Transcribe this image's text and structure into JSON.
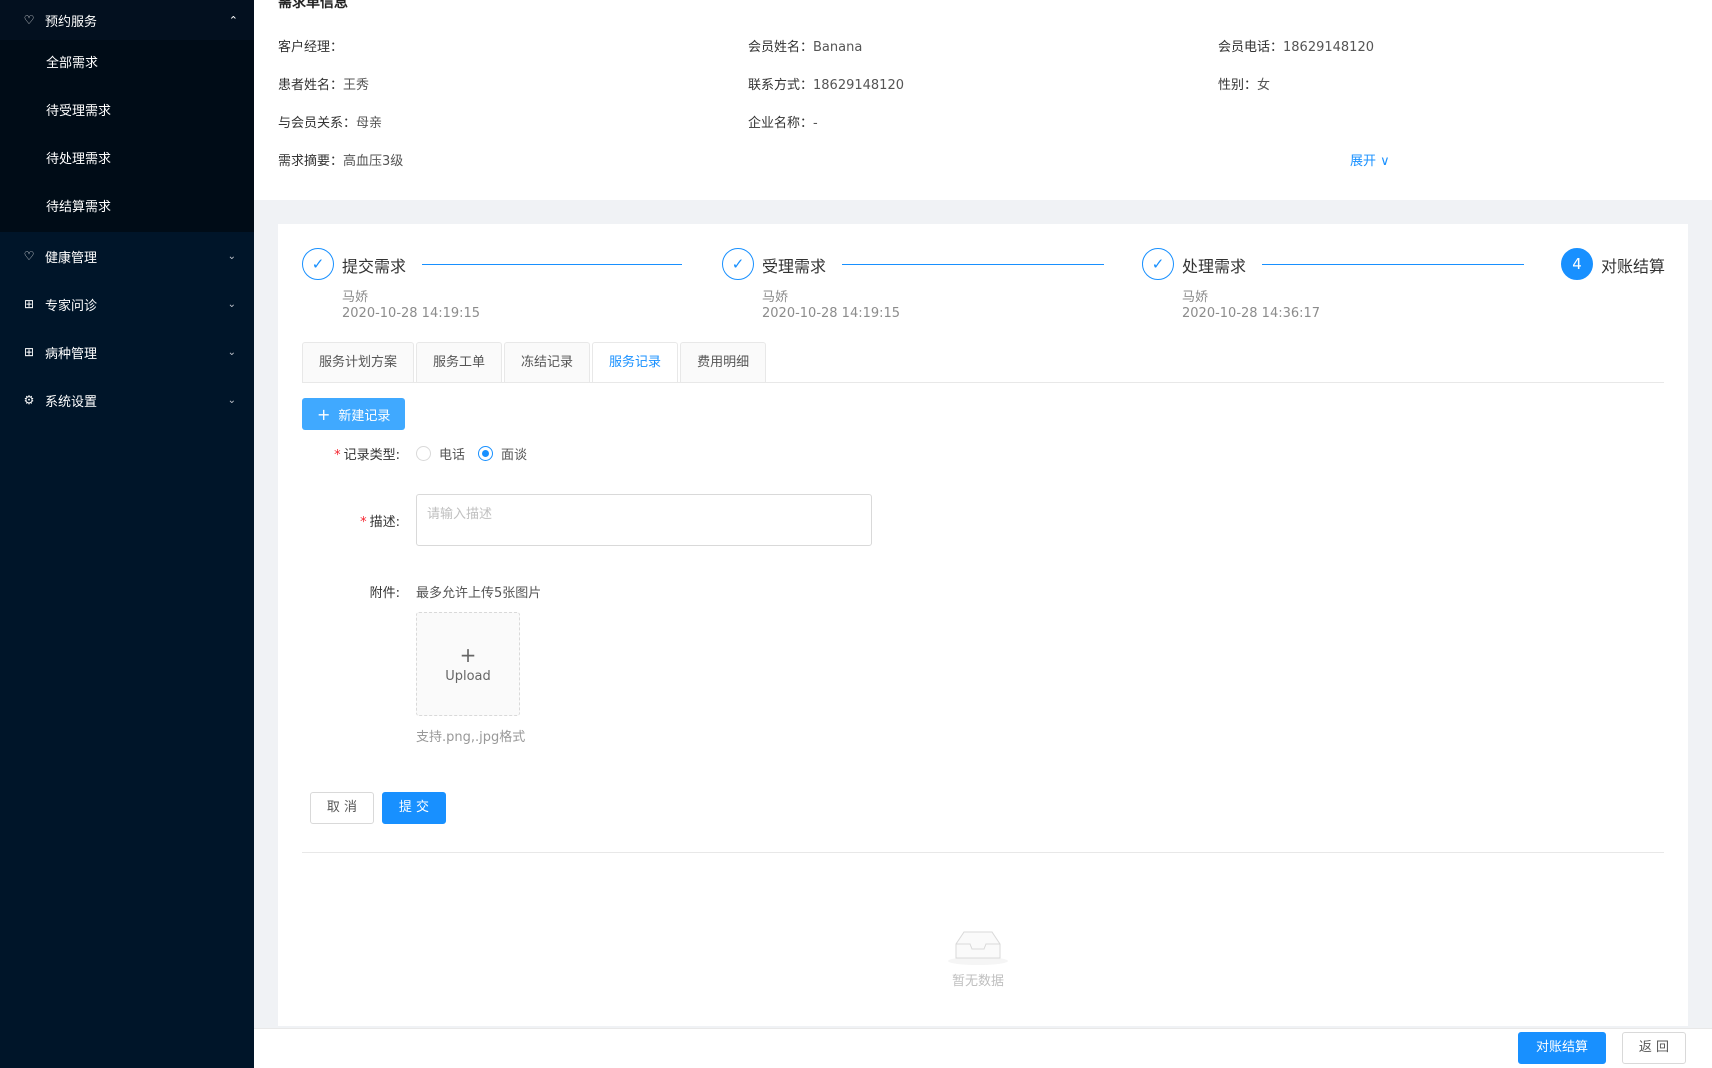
{
  "sidebar": {
    "open_group": {
      "label": "预约服务",
      "icon": "heart-icon"
    },
    "sub_items": [
      "全部需求",
      "待受理需求",
      "待处理需求",
      "待结算需求"
    ],
    "items": [
      {
        "label": "健康管理",
        "icon": "heart-icon"
      },
      {
        "label": "专家问诊",
        "icon": "medical-icon"
      },
      {
        "label": "病种管理",
        "icon": "medical-icon"
      },
      {
        "label": "系统设置",
        "icon": "gear-icon"
      }
    ]
  },
  "info": {
    "title": "需求单信息",
    "fields": [
      {
        "label": "客户经理：",
        "value": ""
      },
      {
        "label": "会员姓名：",
        "value": "Banana"
      },
      {
        "label": "会员电话：",
        "value": "18629148120"
      },
      {
        "label": "患者姓名：",
        "value": "王秀"
      },
      {
        "label": "联系方式：",
        "value": "18629148120"
      },
      {
        "label": "性别：",
        "value": "女"
      },
      {
        "label": "与会员关系：",
        "value": "母亲"
      },
      {
        "label": "企业名称：",
        "value": "-"
      },
      {
        "label": "需求摘要：",
        "value": "高血压3级"
      }
    ],
    "expand_label": "展开"
  },
  "steps": [
    {
      "title": "提交需求",
      "user": "马娇",
      "time": "2020-10-28 14:19:15",
      "status": "done"
    },
    {
      "title": "受理需求",
      "user": "马娇",
      "time": "2020-10-28 14:19:15",
      "status": "done"
    },
    {
      "title": "处理需求",
      "user": "马娇",
      "time": "2020-10-28 14:36:17",
      "status": "done"
    },
    {
      "title": "对账结算",
      "number": "4",
      "status": "active"
    }
  ],
  "tabs": [
    "服务计划方案",
    "服务工单",
    "冻结记录",
    "服务记录",
    "费用明细"
  ],
  "active_tab": "服务记录",
  "form": {
    "new_button": "新建记录",
    "record_type_label": "记录类型:",
    "options": [
      "电话",
      "面谈"
    ],
    "selected_option": "面谈",
    "description_label": "描述:",
    "description_placeholder": "请输入描述",
    "attachment_label": "附件:",
    "attachment_note": "最多允许上传5张图片",
    "upload_label": "Upload",
    "format_hint": "支持.png,.jpg格式",
    "cancel_label": "取 消",
    "submit_label": "提 交"
  },
  "empty_text": "暂无数据",
  "footer": {
    "settle_label": "对账结算",
    "back_label": "返 回"
  },
  "colors": {
    "sidebar_bg": "#001529",
    "primary": "#1890ff",
    "required": "#f5222d"
  }
}
